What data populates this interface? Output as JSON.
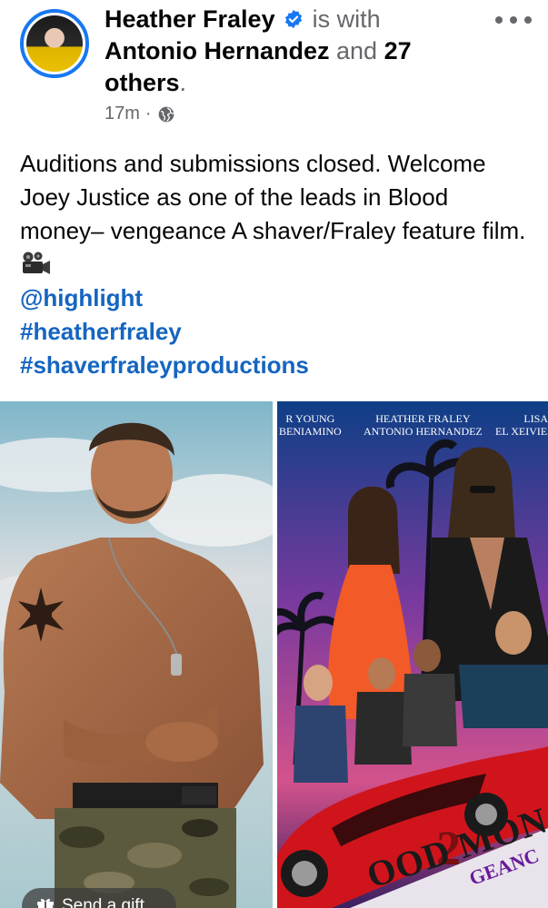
{
  "post": {
    "author_name": "Heather Fraley",
    "with_prefix": "is with",
    "tagged_person": "Antonio Hernandez",
    "and_text": "and",
    "others_count": "27",
    "others_label": "others",
    "period": ".",
    "time_ago": "17m",
    "separator": "·",
    "privacy_icon": "globe-icon",
    "more_icon": "more-horizontal-icon",
    "verified_icon": "verified-badge-icon",
    "verified_color": "#1877f2"
  },
  "body": {
    "text": "Auditions and submissions closed. Welcome Joey Justice as one of the leads in Blood money– vengeance A shaver/Fraley feature film.",
    "emoji_icon": "movie-camera-icon",
    "mention": "@highlight",
    "hashtag_1": "#heatherfraley",
    "hashtag_2": "#shaverfraleyproductions",
    "link_color": "#1565c0"
  },
  "poster": {
    "credit_left_1": "R YOUNG",
    "credit_left_2": "BENIAMINO",
    "credit_mid_1": "HEATHER FRALEY",
    "credit_mid_2": "ANTONIO HERNANDEZ",
    "credit_right_1": "LISA",
    "credit_right_2": "EL XEIVIEI",
    "title": "OOD MON",
    "subtitle": "GEANC",
    "number": "2"
  },
  "actions": {
    "gift_label": "Send a gift",
    "gift_icon": "gift-icon"
  }
}
